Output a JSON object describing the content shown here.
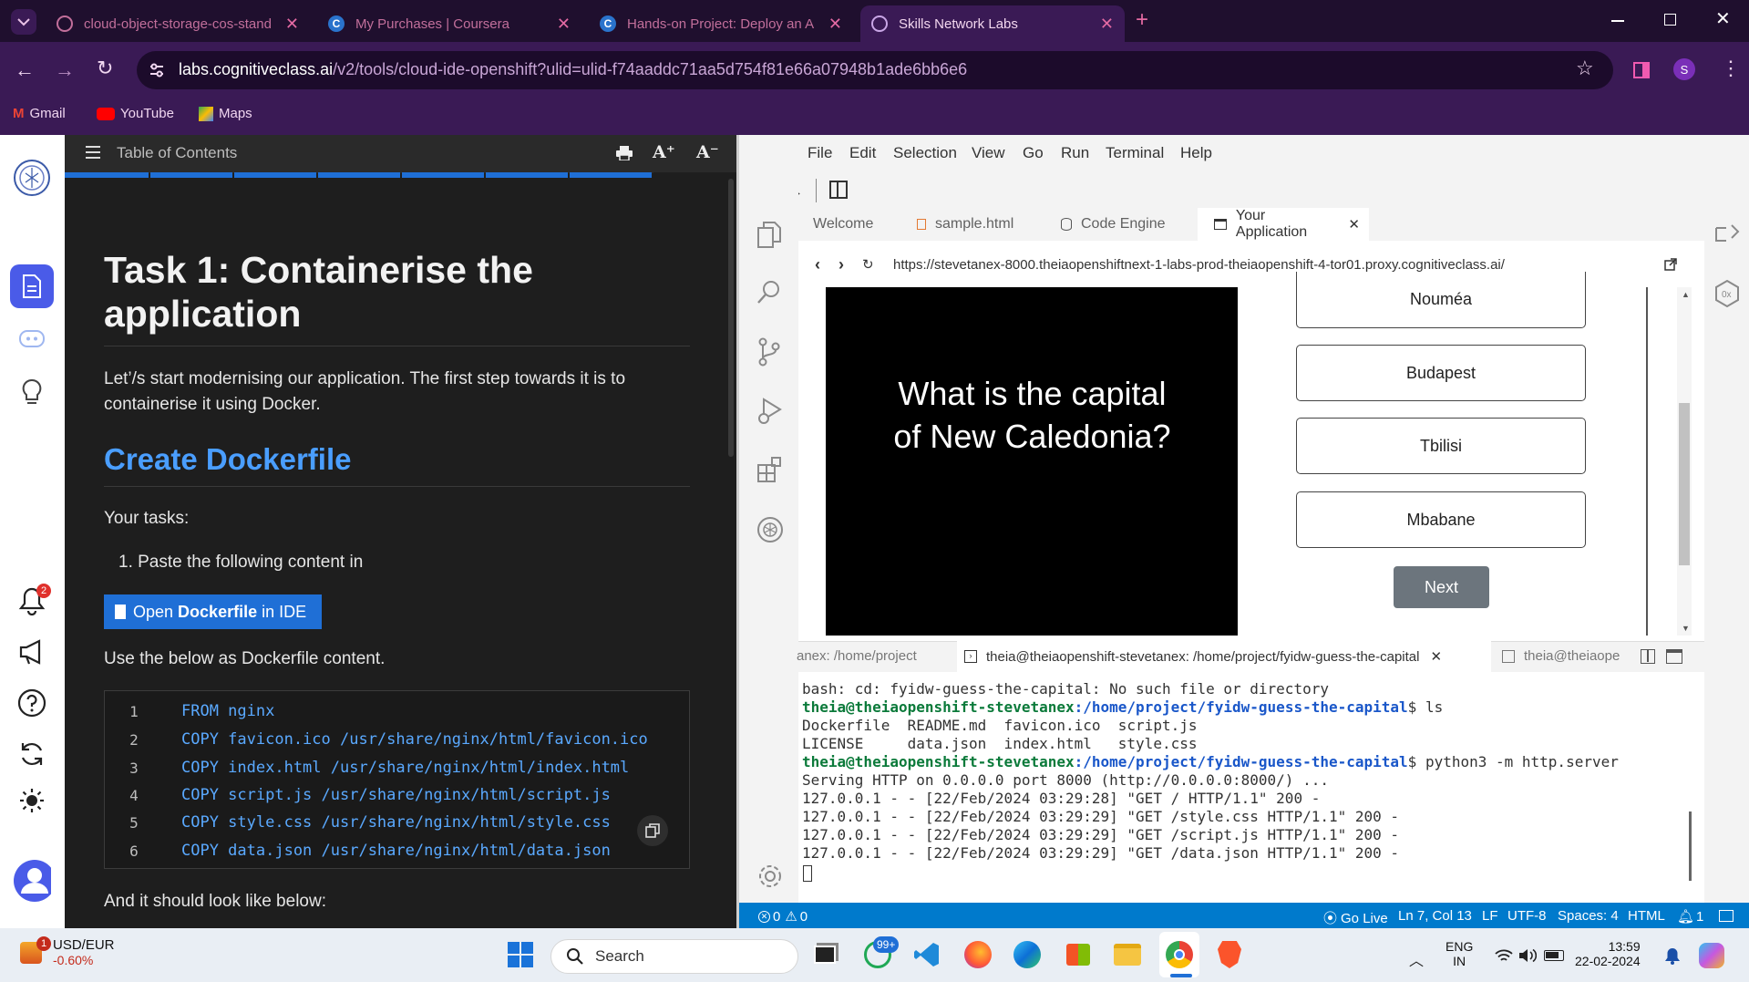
{
  "browser": {
    "tabs": [
      {
        "title": "cloud-object-storage-cos-stand",
        "active": false
      },
      {
        "title": "My Purchases | Coursera",
        "active": false
      },
      {
        "title": "Hands-on Project: Deploy an A",
        "active": false
      },
      {
        "title": "Skills Network Labs",
        "active": true
      }
    ],
    "url_domain": "labs.cognitiveclass.ai",
    "url_path": "/v2/tools/cloud-ide-openshift?ulid=ulid-f74aaddc71aa5d754f81e66a07948b1ade6bb6e6",
    "profile_initial": "S",
    "bookmarks": [
      "Gmail",
      "YouTube",
      "Maps"
    ]
  },
  "rail": {
    "notification_count": "2"
  },
  "instructions": {
    "toc_label": "Table of Contents",
    "font_up": "A⁺",
    "font_down": "A⁻",
    "title": "Task 1: Containerise the application",
    "intro": "Let’/s start modernising our application. The first step towards it is to containerise it using Docker.",
    "h2": "Create Dockerfile",
    "tasks_label": "Your tasks:",
    "task1": "1. Paste the following content in",
    "open_btn_pre": "Open ",
    "open_btn_bold": "Dockerfile",
    "open_btn_post": " in IDE",
    "use_below": "Use the below as Dockerfile content.",
    "code_lines": [
      {
        "n": "1",
        "text": "FROM nginx"
      },
      {
        "n": "2",
        "text": "COPY favicon.ico /usr/share/nginx/html/favicon.ico"
      },
      {
        "n": "3",
        "text": "COPY index.html /usr/share/nginx/html/index.html"
      },
      {
        "n": "4",
        "text": "COPY script.js /usr/share/nginx/html/script.js"
      },
      {
        "n": "5",
        "text": "COPY style.css /usr/share/nginx/html/style.css"
      },
      {
        "n": "6",
        "text": "COPY data.json /usr/share/nginx/html/data.json"
      }
    ],
    "look_below": "And it should look like below:"
  },
  "ide": {
    "menu": [
      "File",
      "Edit",
      "Selection",
      "View",
      "Go",
      "Run",
      "Terminal",
      "Help"
    ],
    "tabs": [
      {
        "label": "Welcome"
      },
      {
        "label": "sample.html"
      },
      {
        "label": "Code Engine"
      },
      {
        "label": "Your Application"
      }
    ],
    "preview_url": "https://stevetanex-8000.theiaopenshiftnext-1-labs-prod-theiaopenshift-4-tor01.proxy.cognitiveclass.ai/",
    "quiz": {
      "question": "What is the capital of New Caledonia?",
      "answers": [
        "Nouméa",
        "Budapest",
        "Tbilisi",
        "Mbabane"
      ],
      "next": "Next"
    },
    "terminal_tabs": [
      "anex: /home/project",
      "theia@theiaopenshift-stevetanex: /home/project/fyidw-guess-the-capital",
      "theia@theiaope"
    ],
    "terminal": {
      "line1": "bash: cd: fyidw-guess-the-capital: No such file or directory",
      "prompt": "theia@theiaopenshift-stevetanex",
      "path": ":/home/project/fyidw-guess-the-capital",
      "cmd1": "$ ls",
      "ls1": "Dockerfile  README.md  favicon.ico  script.js",
      "ls2": "LICENSE     data.json  index.html   style.css",
      "cmd2": "$ python3 -m http.server",
      "serving": "Serving HTTP on 0.0.0.0 port 8000 (http://0.0.0.0:8000/) ...",
      "log": [
        "127.0.0.1 - - [22/Feb/2024 03:29:28] \"GET / HTTP/1.1\" 200 -",
        "127.0.0.1 - - [22/Feb/2024 03:29:29] \"GET /style.css HTTP/1.1\" 200 -",
        "127.0.0.1 - - [22/Feb/2024 03:29:29] \"GET /script.js HTTP/1.1\" 200 -",
        "127.0.0.1 - - [22/Feb/2024 03:29:29] \"GET /data.json HTTP/1.1\" 200 -"
      ]
    },
    "status": {
      "errors": "0",
      "warnings": "0",
      "go_live": "Go Live",
      "position": "Ln 7, Col 13",
      "eol": "LF",
      "encoding": "UTF-8",
      "spaces": "Spaces: 4",
      "language": "HTML",
      "notifications": "1"
    }
  },
  "taskbar": {
    "ticker_name": "USD/EUR",
    "ticker_change": "-0.60%",
    "ticker_badge": "1",
    "search": "Search",
    "whatsapp_badge": "99+",
    "lang1": "ENG",
    "lang2": "IN",
    "time": "13:59",
    "date": "22-02-2024"
  },
  "colors": {
    "accent_blue": "#1f6fd6",
    "heading_blue": "#4a9eff",
    "status_blue": "#007acc",
    "browser_frame": "#3a1a55"
  }
}
